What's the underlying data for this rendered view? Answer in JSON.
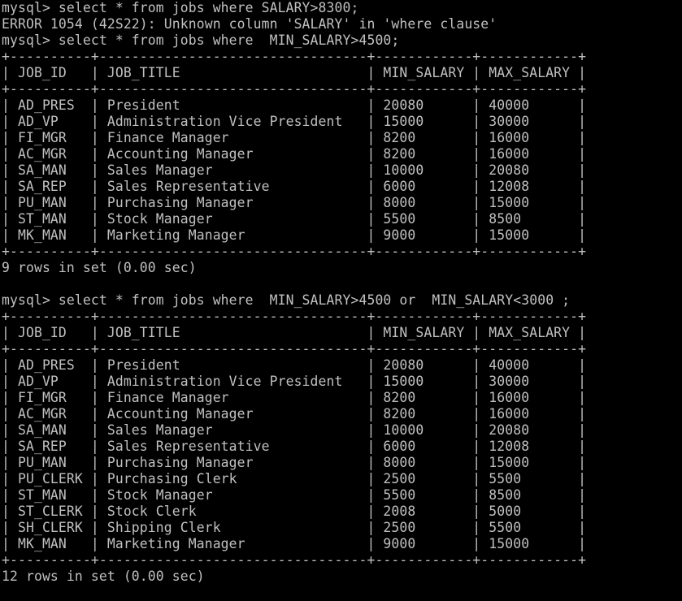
{
  "colors": {
    "background": "#000000",
    "text": "#c0c0c0"
  },
  "lines": [
    "mysql> select * from jobs where SALARY>8300;",
    "ERROR 1054 (42S22): Unknown column 'SALARY' in 'where clause'",
    "mysql> select * from jobs where  MIN_SALARY>4500;",
    "+----------+---------------------------------+------------+------------+",
    "| JOB_ID   | JOB_TITLE                       | MIN_SALARY | MAX_SALARY |",
    "+----------+---------------------------------+------------+------------+",
    "| AD_PRES  | President                       | 20080      | 40000      |",
    "| AD_VP    | Administration Vice President   | 15000      | 30000      |",
    "| FI_MGR   | Finance Manager                 | 8200       | 16000      |",
    "| AC_MGR   | Accounting Manager              | 8200       | 16000      |",
    "| SA_MAN   | Sales Manager                   | 10000      | 20080      |",
    "| SA_REP   | Sales Representative            | 6000       | 12008      |",
    "| PU_MAN   | Purchasing Manager              | 8000       | 15000      |",
    "| ST_MAN   | Stock Manager                   | 5500       | 8500       |",
    "| MK_MAN   | Marketing Manager               | 9000       | 15000      |",
    "+----------+---------------------------------+------------+------------+",
    "9 rows in set (0.00 sec)",
    "",
    "mysql> select * from jobs where  MIN_SALARY>4500 or  MIN_SALARY<3000 ;",
    "+----------+---------------------------------+------------+------------+",
    "| JOB_ID   | JOB_TITLE                       | MIN_SALARY | MAX_SALARY |",
    "+----------+---------------------------------+------------+------------+",
    "| AD_PRES  | President                       | 20080      | 40000      |",
    "| AD_VP    | Administration Vice President   | 15000      | 30000      |",
    "| FI_MGR   | Finance Manager                 | 8200       | 16000      |",
    "| AC_MGR   | Accounting Manager              | 8200       | 16000      |",
    "| SA_MAN   | Sales Manager                   | 10000      | 20080      |",
    "| SA_REP   | Sales Representative            | 6000       | 12008      |",
    "| PU_MAN   | Purchasing Manager              | 8000       | 15000      |",
    "| PU_CLERK | Purchasing Clerk                | 2500       | 5500       |",
    "| ST_MAN   | Stock Manager                   | 5500       | 8500       |",
    "| ST_CLERK | Stock Clerk                     | 2008       | 5000       |",
    "| SH_CLERK | Shipping Clerk                  | 2500       | 5500       |",
    "| MK_MAN   | Marketing Manager               | 9000       | 15000      |",
    "+----------+---------------------------------+------------+------------+",
    "12 rows in set (0.00 sec)",
    ""
  ]
}
